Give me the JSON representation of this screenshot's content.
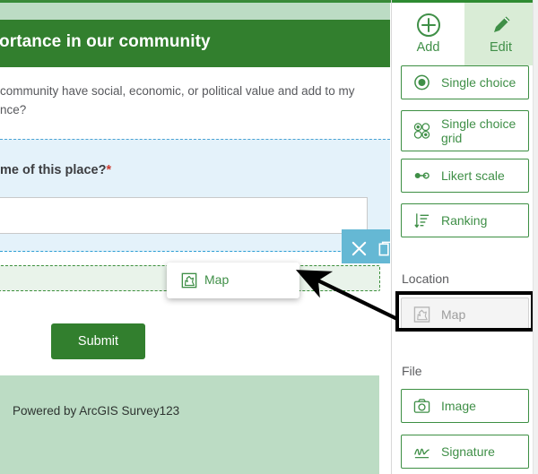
{
  "form": {
    "header_title": "ortance in our community",
    "description_line1": "community have social, economic, or political value and add to my",
    "description_line2": "nce?",
    "question_label": "me of this place?",
    "required_marker": "*",
    "input_value": "",
    "input_placeholder": "",
    "toolbar": {
      "close_icon": "close-icon",
      "duplicate_icon": "duplicate-icon"
    },
    "drag_card": {
      "label": "Map",
      "icon": "map-icon"
    },
    "submit_label": "Submit",
    "footer_text": "Powered by ArcGIS Survey123"
  },
  "sidebar": {
    "tabs": [
      {
        "label": "Add",
        "icon": "plus-circle-icon",
        "active": false
      },
      {
        "label": "Edit",
        "icon": "pencil-icon",
        "active": true
      }
    ],
    "question_types": [
      {
        "label": "Single choice",
        "icon": "radio-selected-icon",
        "disabled": false
      },
      {
        "label": "Single choice grid",
        "icon": "radio-grid-icon",
        "disabled": false
      },
      {
        "label": "Likert scale",
        "icon": "likert-icon",
        "disabled": false
      },
      {
        "label": "Ranking",
        "icon": "ranking-icon",
        "disabled": false
      }
    ],
    "sections": [
      {
        "title": "Location",
        "items": [
          {
            "label": "Map",
            "icon": "map-icon",
            "disabled": true
          }
        ]
      },
      {
        "title": "File",
        "items": [
          {
            "label": "Image",
            "icon": "camera-icon",
            "disabled": false
          },
          {
            "label": "Signature",
            "icon": "signature-icon",
            "disabled": false
          }
        ]
      }
    ]
  },
  "annotation": {
    "highlight_target": "Map",
    "arrow_from": "sidebar-map-button",
    "arrow_to": "form-drop-zone"
  },
  "colors": {
    "brand_green": "#327f2e",
    "light_green": "#bcdcc4",
    "accent_green": "#3f8f47",
    "selected_blue": "#e4f2fa",
    "toolbar_teal": "#65b8d4",
    "required_red": "#cc3b30",
    "annotation_black": "#000000"
  }
}
